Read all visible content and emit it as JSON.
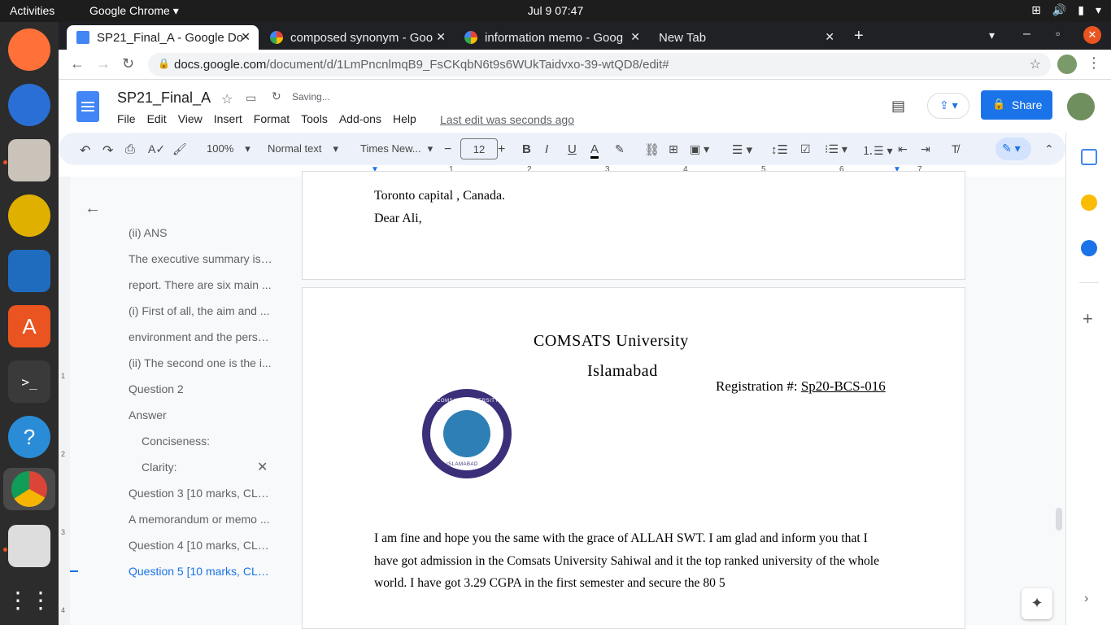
{
  "system": {
    "activities": "Activities",
    "app_menu": "Google Chrome ▾",
    "clock": "Jul 9  07:47"
  },
  "browser": {
    "tabs": [
      {
        "label": "SP21_Final_A - Google Do",
        "close": "✕"
      },
      {
        "label": "composed synonym - Goo",
        "close": "✕"
      },
      {
        "label": "information memo - Goog",
        "close": "✕"
      },
      {
        "label": "New Tab",
        "close": "✕"
      }
    ],
    "url_host": "docs.google.com",
    "url_path": "/document/d/1LmPncnlmqB9_FsCKqbN6t9s6WUkTaidvxo-39-wtQD8/edit#"
  },
  "docs": {
    "title": "SP21_Final_A",
    "saving": "Saving...",
    "menus": [
      "File",
      "Edit",
      "View",
      "Insert",
      "Format",
      "Tools",
      "Add-ons",
      "Help"
    ],
    "last_edit": "Last edit was seconds ago",
    "share": "Share",
    "toolbar": {
      "zoom": "100%",
      "style": "Normal text",
      "font": "Times New...",
      "size": "12"
    },
    "ruler_numbers": [
      "1",
      "2",
      "3",
      "4",
      "5",
      "6",
      "7"
    ],
    "vruler_numbers": [
      "1",
      "2",
      "3",
      "4"
    ]
  },
  "outline": {
    "items": [
      "(ii) ANS",
      "The executive summary is ...",
      "report. There are six main ...",
      "(i) First of all, the aim and ...",
      "environment and the perso...",
      "(ii) The second one is the i...",
      "Question 2",
      "Answer",
      "Conciseness:",
      "Clarity:",
      "Question 3 [10 marks, CLO...",
      "A memorandum or memo ...",
      "Question 4 [10 marks, CLO...",
      "Question 5 [10 marks, CLO..."
    ]
  },
  "page1": {
    "line1": "Toronto capital , Canada.",
    "line2": "Dear Ali,"
  },
  "page2": {
    "university": "COMSATS University",
    "city": "Islamabad",
    "reg_label": "Registration #:",
    "reg_value": " Sp20-BCS-016",
    "para1": "I am fine and hope you the same with the grace of  ALLAH SWT. I am glad and inform you that I",
    "para2": "have got admission in the Comsats University Sahiwal and it the top ranked university of the whole",
    "para3": "world. I have got 3.29 CGPA in the first semester and secure the 80 5",
    "seal_text_top": "COMSATS UNIVERSITY",
    "seal_text_bottom": "ISLAMABAD"
  },
  "colors": {
    "accent": "#1a73e8",
    "docs_blue": "#4285f4"
  }
}
